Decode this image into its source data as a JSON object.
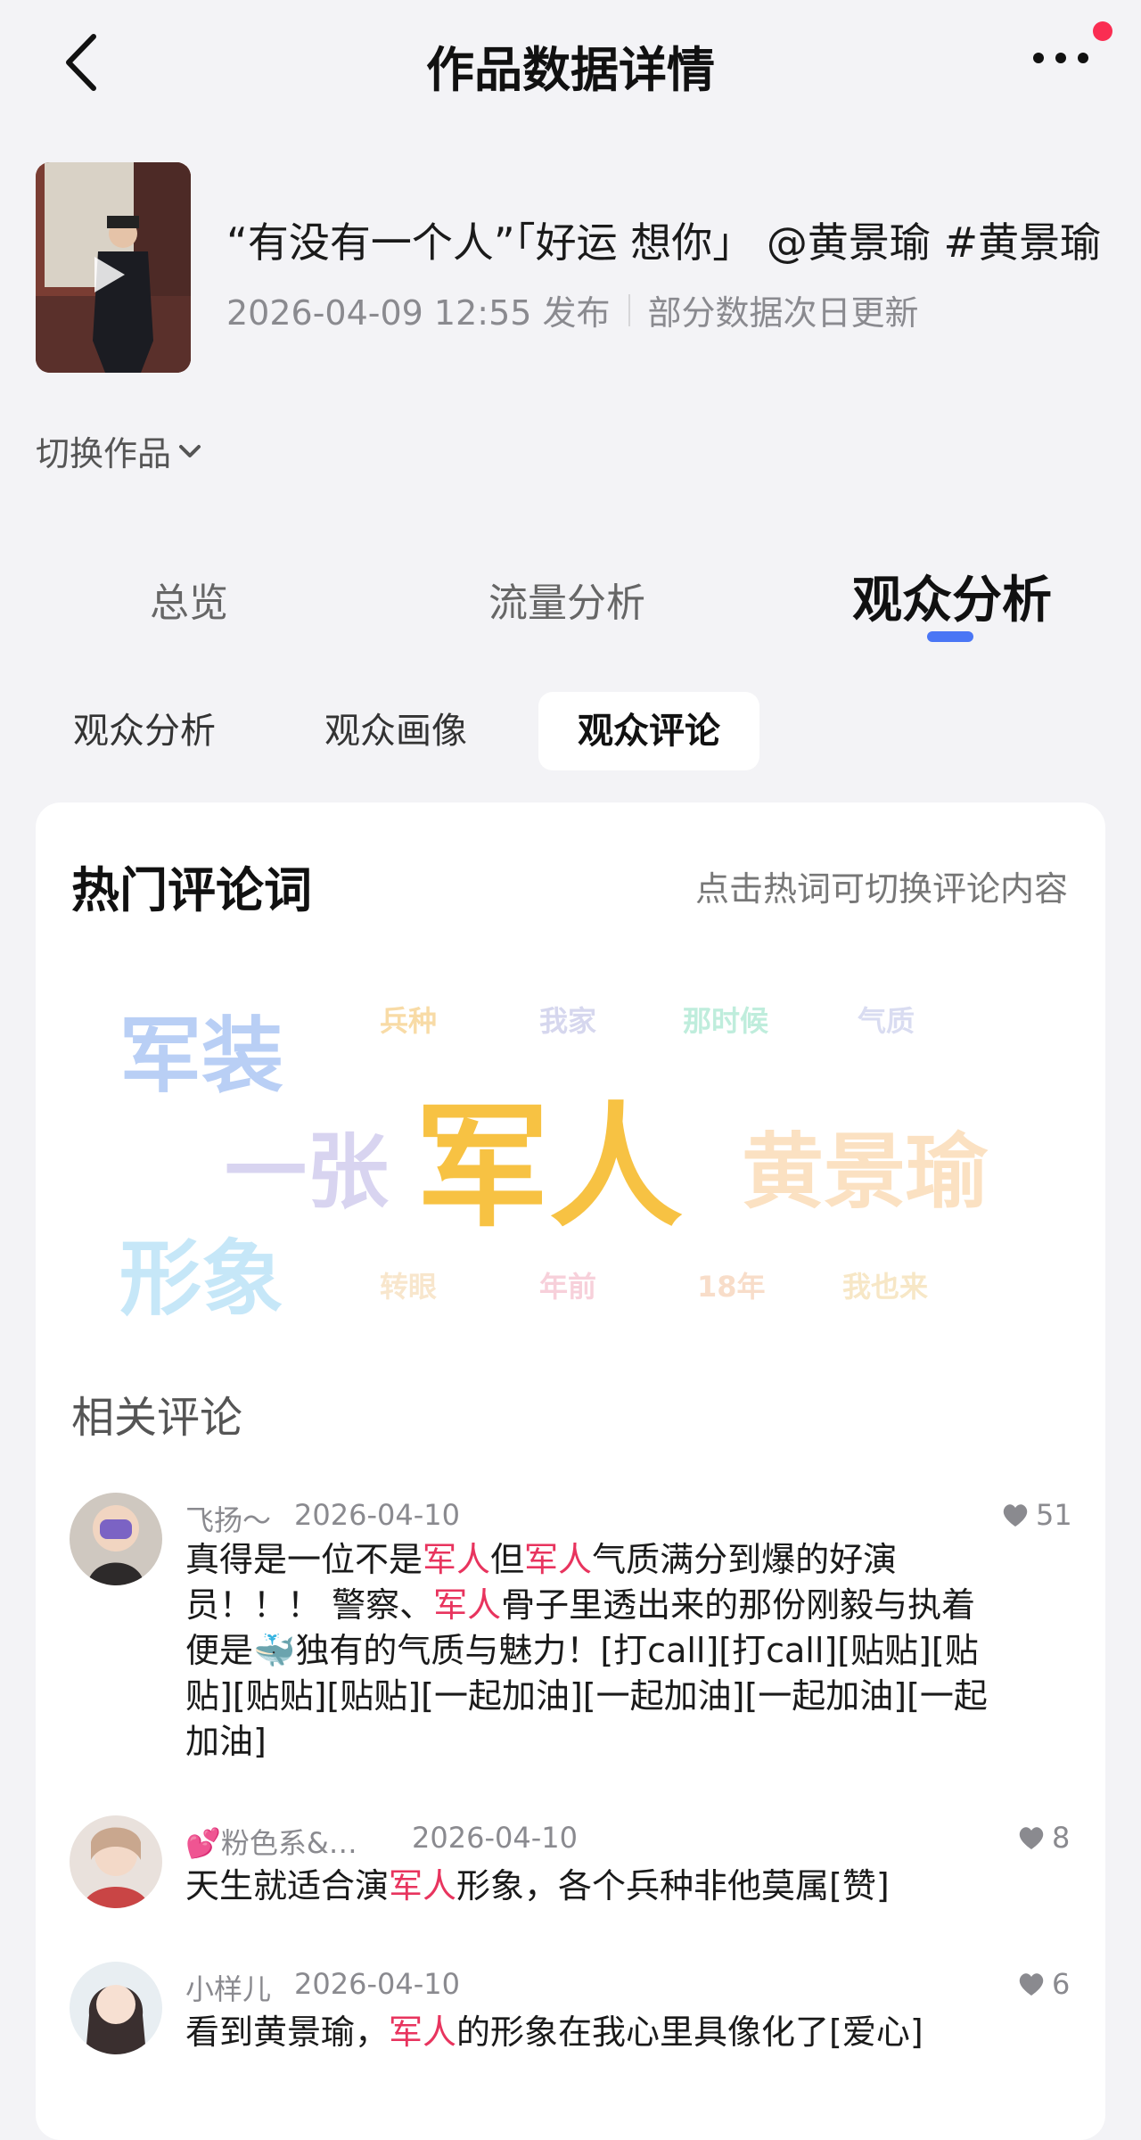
{
  "header": {
    "title": "作品数据详情"
  },
  "work": {
    "title": "“有没有一个人”「好运 想你」 @黄景瑜 #黄景瑜",
    "publish_time": "2026-04-09 12:55 发布",
    "update_note": "部分数据次日更新",
    "switch_label": "切换作品"
  },
  "main_tabs": [
    {
      "label": "总览"
    },
    {
      "label": "流量分析"
    },
    {
      "label": "观众分析"
    }
  ],
  "sub_tabs": [
    {
      "label": "观众分析"
    },
    {
      "label": "观众画像"
    },
    {
      "label": "观众评论"
    }
  ],
  "hot_words": {
    "title": "热门评论词",
    "hint": "点击热词可切换评论内容",
    "words": [
      {
        "text": "军装",
        "color": "#b9cff5"
      },
      {
        "text": "兵种",
        "color": "#f8dba6"
      },
      {
        "text": "我家",
        "color": "#d6d7ee"
      },
      {
        "text": "那时候",
        "color": "#bfeddc"
      },
      {
        "text": "气质",
        "color": "#d9dcf1"
      },
      {
        "text": "一张",
        "color": "#d8d4f0"
      },
      {
        "text": "军人",
        "color": "#f7c243"
      },
      {
        "text": "黄景瑜",
        "color": "#fbe1c2"
      },
      {
        "text": "形象",
        "color": "#c6e7f8"
      },
      {
        "text": "转眼",
        "color": "#f8e6cc"
      },
      {
        "text": "年前",
        "color": "#f7d0da"
      },
      {
        "text": "18年",
        "color": "#f8ddc9"
      },
      {
        "text": "我也来",
        "color": "#f7e7c6"
      }
    ]
  },
  "related": {
    "title": "相关评论",
    "comments": [
      {
        "author": "飞扬～",
        "date": "2026-04-10",
        "likes": "51",
        "text_parts": [
          "真得是一位不是",
          "军人",
          "但",
          "军人",
          "气质满分到爆的好演员！！！ 警察、",
          "军人",
          "骨子里透出来的那份刚毅与执着便是",
          "🐳",
          "独有的气质与魅力！[打call][打call][贴贴][贴贴][贴贴][贴贴][一起加油][一起加油][一起加油][一起加油]"
        ]
      },
      {
        "author": "💕粉色系&…",
        "date": "2026-04-10",
        "likes": "8",
        "text_parts": [
          "天生就适合演",
          "军人",
          "形象，各个兵种非他莫属[赞]"
        ]
      },
      {
        "author": "小样儿",
        "date": "2026-04-10",
        "likes": "6",
        "text_parts": [
          "看到黄景瑜，",
          "军人",
          "的形象在我心里具像化了[爱心]"
        ]
      }
    ]
  },
  "colors": {
    "accent": "#4a76f5",
    "highlight": "#e8345e",
    "notify": "#fa2d52"
  }
}
